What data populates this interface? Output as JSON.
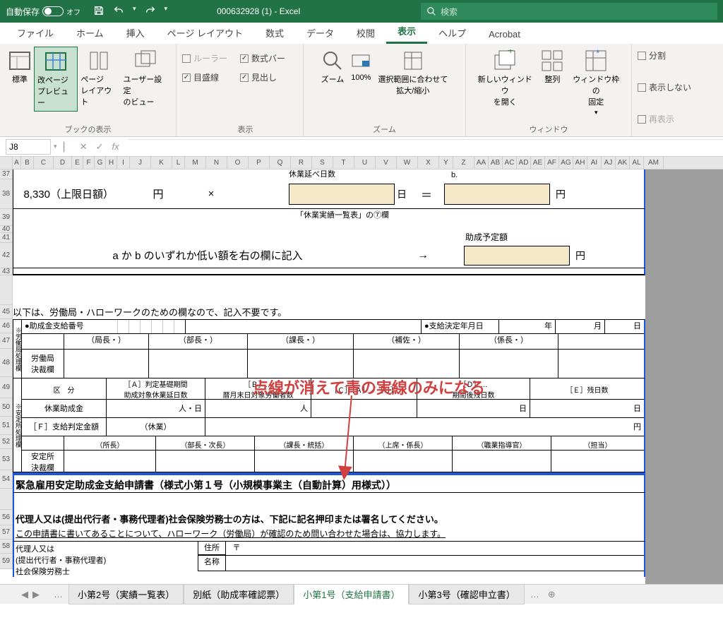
{
  "titlebar": {
    "autosave_label": "自動保存",
    "autosave_state": "オフ",
    "filename": "000632928 (1)  -  Excel",
    "search_placeholder": "検索"
  },
  "tabs": {
    "file": "ファイル",
    "home": "ホーム",
    "insert": "挿入",
    "page_layout": "ページ レイアウト",
    "formulas": "数式",
    "data": "データ",
    "review": "校閲",
    "view": "表示",
    "help": "ヘルプ",
    "acrobat": "Acrobat"
  },
  "ribbon": {
    "normal": "標準",
    "page_break": "改ページ\nプレビュー",
    "page_layout": "ページ\nレイアウト",
    "custom_view": "ユーザー設定\nのビュー",
    "group_views": "ブックの表示",
    "ruler": "ルーラー",
    "formula_bar": "数式バー",
    "gridlines": "目盛線",
    "headings": "見出し",
    "group_show": "表示",
    "zoom": "ズーム",
    "zoom100": "100%",
    "zoom_selection": "選択範囲に合わせて\n拡大/縮小",
    "group_zoom": "ズーム",
    "new_window": "新しいウィンドウ\nを開く",
    "arrange": "整列",
    "freeze": "ウィンドウ枠の\n固定",
    "split": "分割",
    "hide": "表示しない",
    "unhide": "再表示",
    "group_window": "ウィンドウ"
  },
  "formula_bar": {
    "name_box": "J8",
    "fx": "fx"
  },
  "columns": [
    "",
    "A",
    "B",
    "C",
    "D",
    "E",
    "F",
    "G",
    "H",
    "I",
    "J",
    "K",
    "L",
    "M",
    "N",
    "O",
    "P",
    "Q",
    "R",
    "S",
    "T",
    "U",
    "V",
    "W",
    "X",
    "Y",
    "Z",
    "AA",
    "AB",
    "AC",
    "AD",
    "AE",
    "AF",
    "AG",
    "AH",
    "AI",
    "AJ",
    "AK",
    "AL",
    "AM"
  ],
  "rows": [
    "37",
    "38",
    "39",
    "40",
    "41",
    "42",
    "43",
    "",
    "45",
    "46",
    "47",
    "48",
    "49",
    "50",
    "51",
    "52",
    "53",
    "54",
    "",
    "56",
    "57",
    "58",
    "59"
  ],
  "form": {
    "upper_limit": "8,330（上限日額）",
    "yen": "円",
    "multiply": "×",
    "days_header": "休業延べ日数",
    "days_unit": "日",
    "equals": "＝",
    "b_label": "b.",
    "note_col7": "「休業実績一覧表」の⑦欄",
    "expected_amount": "助成予定額",
    "instruction": "a か b のいずれか低い額を右の欄に記入",
    "arrow": "→",
    "section_note": "以下は、労働局・ハローワークのための欄なので、記入不要です。",
    "grant_number": "●助成金支給番号",
    "decision_date": "●支給決定年月日",
    "year": "年",
    "month": "月",
    "day": "日",
    "director": "（局長・",
    "dept_head": "（部長・",
    "section_head": "（課長・",
    "assistant": "（補佐・",
    "chief": "（係長・",
    "）": "）",
    "labor_approval": "労働局\n決裁欄",
    "category": "区　分",
    "a_period": "［Ａ］判定基礎期間\n助成対象休業延日数",
    "b_end": "［Ｂ］…\n暦月末日対象労働者数",
    "c_ab": "［Ｃ］［Ａ］／［Ｂ］",
    "d_remain": "［Ｄ］…\n期間後残日数",
    "e_remain": "［Ｅ］残日数",
    "leave_grant": "休業助成金",
    "person_day": "人・日",
    "person": "人",
    "f_amount": "［Ｆ］支給判定金額",
    "leave": "（休業）",
    "director2": "（所長）",
    "dept2": "（部長・次長）",
    "section2": "（課長・統括）",
    "senior": "（上席・係長）",
    "guidance": "（職業指導官）",
    "staff": "（担当）",
    "stability_approval": "安定所\n決裁欄",
    "side_label1": "※労働局処理欄",
    "side_label2": "※安定所処理欄",
    "doc_title": "緊急雇用安定助成金支給申請書（様式小第１号（小規模事業主（自動計算）用様式））",
    "agent_note": "代理人又は(提出代行者・事務代理者)社会保険労務士の方は、下記に記名押印または署名してください。",
    "confirm_note": "この申請書に書いてあることについて、ハローワーク（労働局）が確認のため問い合わせた場合は、協力します。",
    "agent_label": "代理人又は\n(提出代行者・事務代理者)\n社会保険労務士",
    "address": "住所",
    "postal": "〒",
    "name": "名称"
  },
  "annotation": "点線が消えて青の実線のみになる",
  "sheet_tabs": {
    "tab1": "小第2号（実績一覧表）",
    "tab2": "別紙（助成率確認票）",
    "tab3": "小第1号（支給申請書）",
    "tab4": "小第3号（確認申立書）"
  }
}
